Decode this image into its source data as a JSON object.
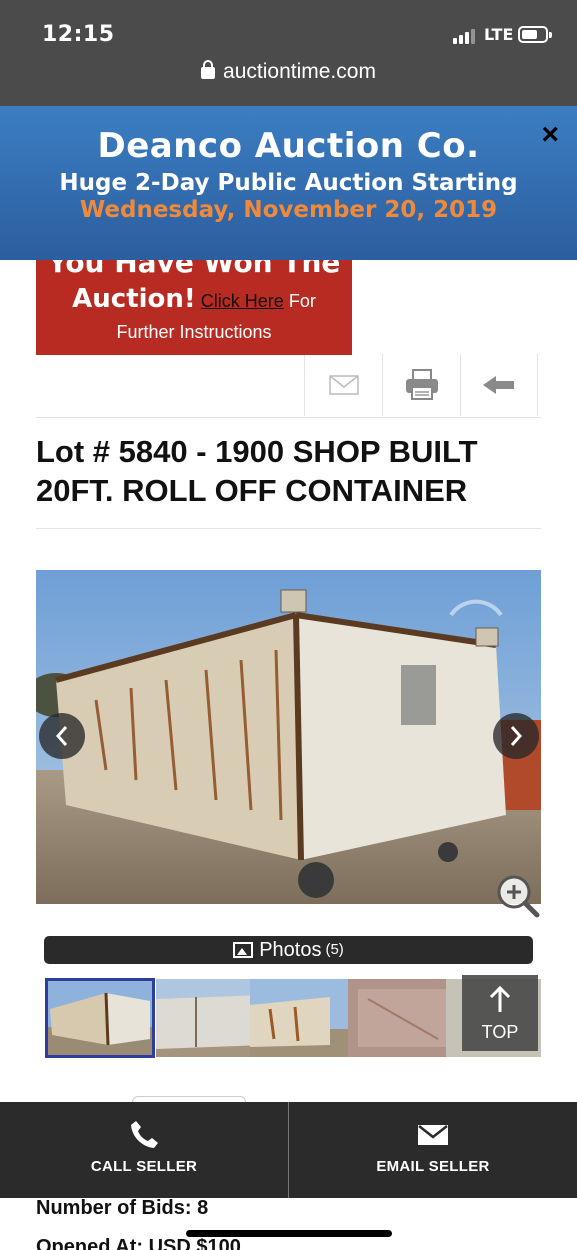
{
  "status_bar": {
    "time": "12:15",
    "network": "LTE",
    "battery_level": 0.7
  },
  "browser": {
    "url": "auctiontime.com"
  },
  "banner": {
    "title": "Deanco Auction Co.",
    "subtitle": "Huge 2-Day Public Auction Starting",
    "date": "Wednesday, November 20, 2019",
    "close_icon": "×",
    "date_color": "#f08a3a",
    "background_color": "#3570b2"
  },
  "won_notice": {
    "line1": "You Have Won The",
    "line2_bold": "Auction!",
    "link_text": "Click Here",
    "line2_rest": "For",
    "line3": "Further Instructions",
    "background_color": "#b82b22"
  },
  "actions": [
    {
      "icon": "envelope-icon"
    },
    {
      "icon": "printer-icon"
    },
    {
      "icon": "back-arrow-icon"
    }
  ],
  "listing": {
    "title": "Lot # 5840 - 1900 SHOP BUILT 20FT. ROLL OFF CONTAINER",
    "number_of_bids_label": "Number of Bids: 8",
    "opened_at_label": "Opened At: USD $100"
  },
  "gallery": {
    "photos_label": "Photos",
    "photos_count": "(5)",
    "thumbnail_count": 5,
    "top_label": "TOP"
  },
  "contact_bar": {
    "call_label": "CALL SELLER",
    "email_label": "EMAIL SELLER"
  }
}
